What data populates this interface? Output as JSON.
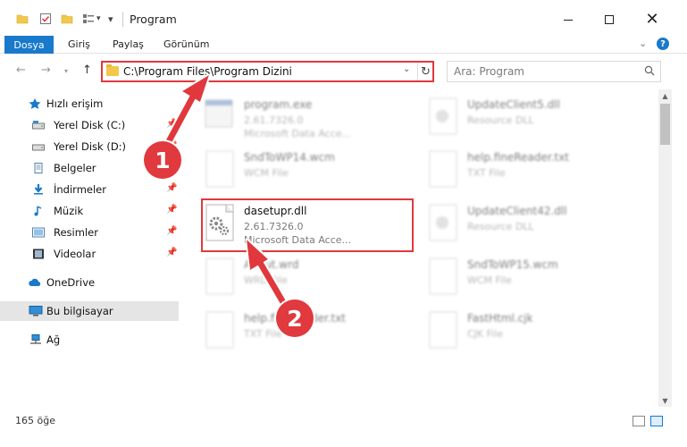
{
  "window": {
    "title": "Program",
    "controls": {
      "minimize": "minimize",
      "maximize": "maximize",
      "close": "✕"
    }
  },
  "ribbon": {
    "file_tab": "Dosya",
    "tabs": [
      "Giriş",
      "Paylaş",
      "Görünüm"
    ],
    "help": "?"
  },
  "address": {
    "path": "C:\\Program Files\\Program Dizini",
    "refresh": "↻"
  },
  "search": {
    "placeholder": "Ara: Program"
  },
  "sidebar": {
    "items": [
      {
        "label": "Hızlı erişim",
        "icon": "star-icon",
        "pinned": false
      },
      {
        "label": "Yerel Disk (C:)",
        "icon": "drive-icon",
        "pinned": true
      },
      {
        "label": "Yerel Disk (D:)",
        "icon": "drive-icon",
        "pinned": true
      },
      {
        "label": "Belgeler",
        "icon": "documents-icon",
        "pinned": true
      },
      {
        "label": "İndirmeler",
        "icon": "download-icon",
        "pinned": true
      },
      {
        "label": "Müzik",
        "icon": "music-icon",
        "pinned": true
      },
      {
        "label": "Resimler",
        "icon": "pictures-icon",
        "pinned": true
      },
      {
        "label": "Videolar",
        "icon": "videos-icon",
        "pinned": true
      },
      {
        "label": "OneDrive",
        "icon": "cloud-icon",
        "pinned": false
      },
      {
        "label": "Bu bilgisayar",
        "icon": "computer-icon",
        "pinned": false
      },
      {
        "label": "Ağ",
        "icon": "network-icon",
        "pinned": false
      }
    ]
  },
  "files": [
    {
      "name": "program.exe",
      "line2": "2.61.7326.0",
      "line3": "Microsoft Data Acce...",
      "icon": "exe-icon"
    },
    {
      "name": "UpdateClient5.dll",
      "line2": "Resource DLL",
      "line3": "",
      "icon": "dll-icon"
    },
    {
      "name": "SndToWP14.wcm",
      "line2": "WCM File",
      "line3": "",
      "icon": "document-icon"
    },
    {
      "name": "help.fineReader.txt",
      "line2": "TXT File",
      "line3": "",
      "icon": "document-icon"
    },
    {
      "name": "dasetupr.dll",
      "line2": "2.61.7326.0",
      "line3": "Microsoft Data Acce...",
      "icon": "dll-icon"
    },
    {
      "name": "UpdateClient42.dll",
      "line2": "Resource DLL",
      "line3": "",
      "icon": "dll-icon"
    },
    {
      "name": "About.wrd",
      "line2": "WRD File",
      "line3": "",
      "icon": "document-icon"
    },
    {
      "name": "SndToWP15.wcm",
      "line2": "WCM File",
      "line3": "",
      "icon": "document-icon"
    },
    {
      "name": "help.fineReader.txt",
      "line2": "TXT File",
      "line3": "",
      "icon": "document-icon"
    },
    {
      "name": "FastHtml.cjk",
      "line2": "CJK File",
      "line3": "",
      "icon": "document-icon"
    }
  ],
  "status": {
    "count": "165 öğe"
  },
  "annotations": {
    "step1": "1",
    "step2": "2"
  },
  "colors": {
    "accent": "#1979ca",
    "annotation": "#e0393e",
    "folder": "#f2c84b"
  }
}
